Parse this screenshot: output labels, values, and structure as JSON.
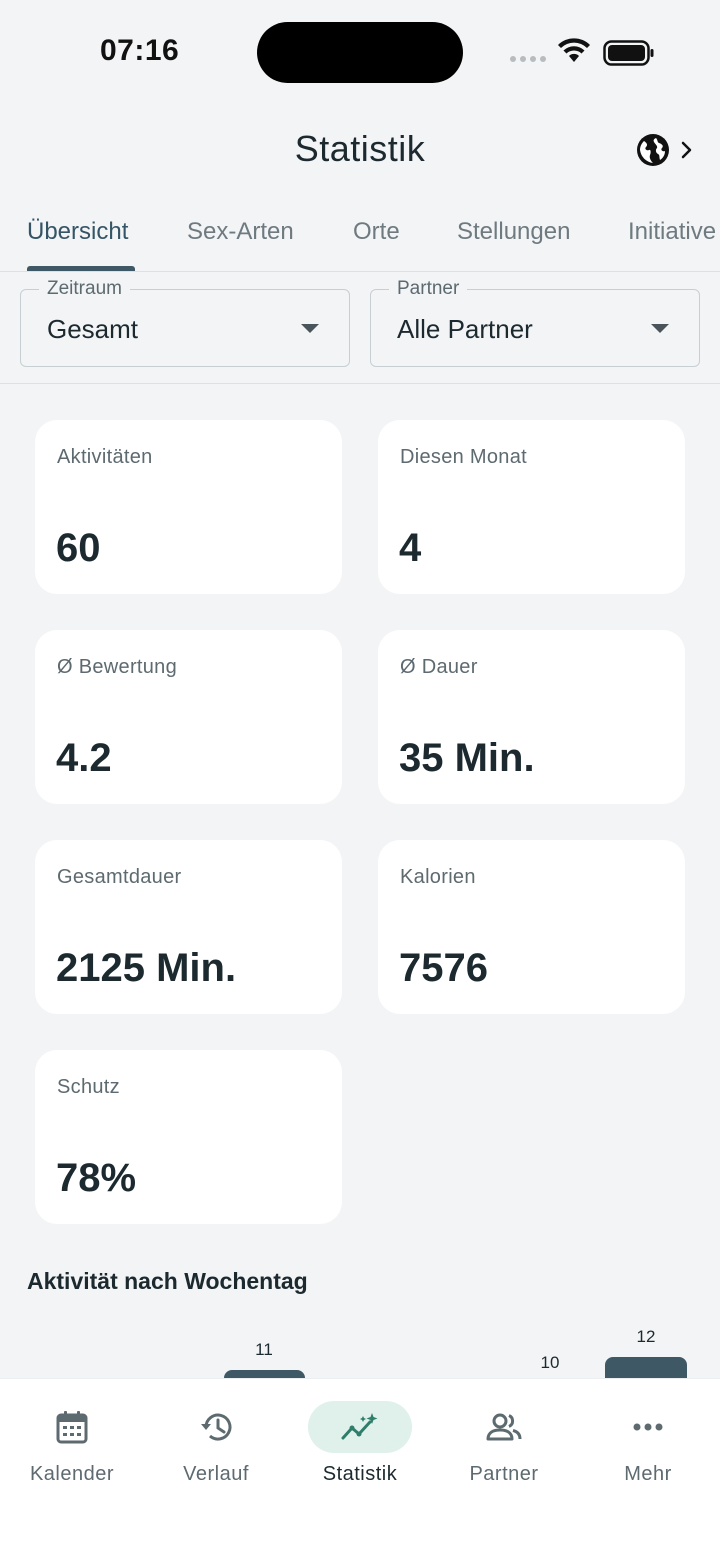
{
  "status_bar": {
    "time": "07:16"
  },
  "header": {
    "title": "Statistik"
  },
  "tabs": [
    {
      "label": "Übersicht",
      "active": true
    },
    {
      "label": "Sex-Arten",
      "active": false
    },
    {
      "label": "Orte",
      "active": false
    },
    {
      "label": "Stellungen",
      "active": false
    },
    {
      "label": "Initiative",
      "active": false
    }
  ],
  "filters": {
    "period": {
      "legend": "Zeitraum",
      "value": "Gesamt"
    },
    "partner": {
      "legend": "Partner",
      "value": "Alle Partner"
    }
  },
  "stats": [
    {
      "label": "Aktivitäten",
      "value": "60"
    },
    {
      "label": "Diesen Monat",
      "value": "4"
    },
    {
      "label": "Ø Bewertung",
      "value": "4.2"
    },
    {
      "label": "Ø Dauer",
      "value": "35 Min."
    },
    {
      "label": "Gesamtdauer",
      "value": "2125 Min."
    },
    {
      "label": "Kalorien",
      "value": "7576"
    },
    {
      "label": "Schutz",
      "value": "78%"
    }
  ],
  "weekday_section": {
    "title": "Aktivität nach Wochentag"
  },
  "chart_data": {
    "type": "bar",
    "title": "Aktivität nach Wochentag",
    "visible_values": [
      11,
      10,
      12
    ]
  },
  "nav": [
    {
      "label": "Kalender",
      "icon": "calendar-icon",
      "active": false
    },
    {
      "label": "Verlauf",
      "icon": "history-icon",
      "active": false
    },
    {
      "label": "Statistik",
      "icon": "stats-icon",
      "active": true
    },
    {
      "label": "Partner",
      "icon": "people-icon",
      "active": false
    },
    {
      "label": "Mehr",
      "icon": "more-icon",
      "active": false
    }
  ],
  "colors": {
    "primary": "#3f5866",
    "active_nav_bg": "#dff1ea",
    "accent_green": "#2f7d6b",
    "background": "#f2f4f5",
    "card": "#ffffff"
  }
}
